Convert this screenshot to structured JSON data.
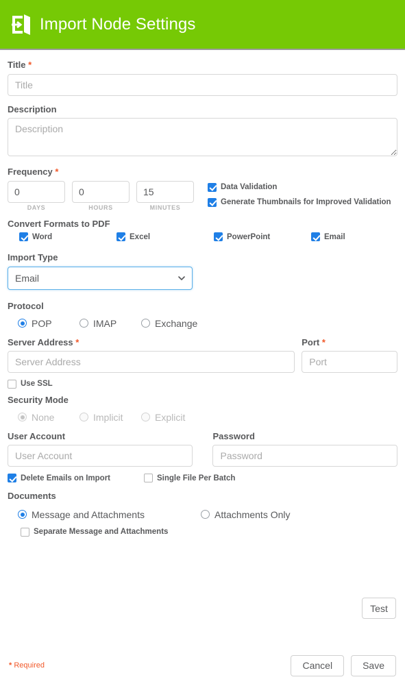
{
  "header": {
    "title": "Import Node Settings",
    "icon": "import-door-icon",
    "background_color": "#76c905"
  },
  "form": {
    "title": {
      "label": "Title",
      "required_marker": "*",
      "value": "",
      "placeholder": "Title"
    },
    "description": {
      "label": "Description",
      "value": "",
      "placeholder": "Description"
    },
    "frequency": {
      "label": "Frequency",
      "required_marker": "*",
      "inputs": [
        {
          "value": "0",
          "unit": "DAYS"
        },
        {
          "value": "0",
          "unit": "HOURS"
        },
        {
          "value": "15",
          "unit": "MINUTES"
        }
      ],
      "checkboxes": [
        {
          "label": "Data Validation",
          "checked": true
        },
        {
          "label": "Generate Thumbnails for Improved Validation",
          "checked": true
        }
      ]
    },
    "convert_formats": {
      "label": "Convert Formats to PDF",
      "options": [
        {
          "label": "Word",
          "checked": true
        },
        {
          "label": "Excel",
          "checked": true
        },
        {
          "label": "PowerPoint",
          "checked": true
        },
        {
          "label": "Email",
          "checked": true
        }
      ]
    },
    "import_type": {
      "label": "Import Type",
      "selected": "Email",
      "options": [
        "Email"
      ]
    },
    "protocol": {
      "label": "Protocol",
      "options": [
        {
          "label": "POP",
          "selected": true
        },
        {
          "label": "IMAP",
          "selected": false
        },
        {
          "label": "Exchange",
          "selected": false
        }
      ]
    },
    "server_address": {
      "label": "Server Address",
      "required_marker": "*",
      "value": "",
      "placeholder": "Server Address"
    },
    "port": {
      "label": "Port",
      "required_marker": "*",
      "value": "",
      "placeholder": "Port"
    },
    "use_ssl": {
      "label": "Use SSL",
      "checked": false
    },
    "security_mode": {
      "label": "Security Mode",
      "disabled": true,
      "options": [
        {
          "label": "None",
          "selected": true
        },
        {
          "label": "Implicit",
          "selected": false
        },
        {
          "label": "Explicit",
          "selected": false
        }
      ]
    },
    "user_account": {
      "label": "User Account",
      "value": "",
      "placeholder": "User Account"
    },
    "password": {
      "label": "Password",
      "value": "",
      "placeholder": "Password"
    },
    "delete_emails": {
      "label": "Delete Emails on Import",
      "checked": true
    },
    "single_file": {
      "label": "Single File Per Batch",
      "checked": false
    },
    "test_button": {
      "label": "Test"
    },
    "documents": {
      "label": "Documents",
      "options": [
        {
          "label": "Message and Attachments",
          "selected": true
        },
        {
          "label": "Attachments Only",
          "selected": false
        }
      ],
      "separate": {
        "label": "Separate Message and Attachments",
        "checked": false
      }
    }
  },
  "footer": {
    "required_star": "*",
    "required_text": "Required",
    "cancel_label": "Cancel",
    "save_label": "Save"
  },
  "colors": {
    "header_green": "#76c905",
    "accent_blue": "#1f7fe6",
    "required_orange": "#f1592a",
    "label_grey": "#58595b"
  }
}
